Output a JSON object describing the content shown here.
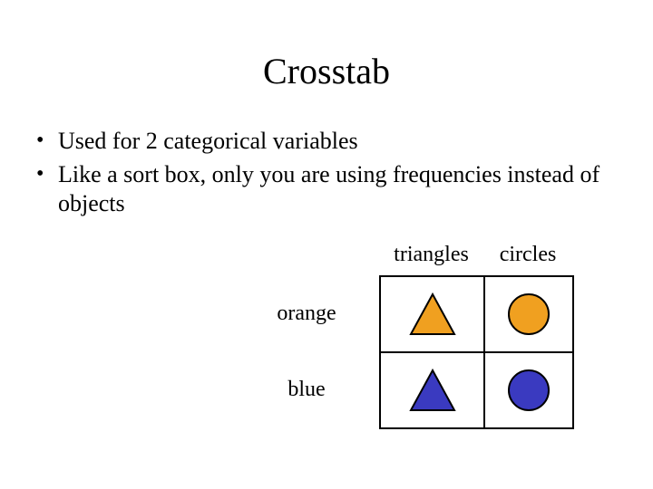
{
  "title": "Crosstab",
  "bullets": [
    "Used for 2 categorical variables",
    "Like a sort box, only you are using frequencies instead of objects"
  ],
  "table": {
    "col_labels": [
      "triangles",
      "circles"
    ],
    "row_labels": [
      "orange",
      "blue"
    ],
    "colors": {
      "orange": "#f0a020",
      "blue": "#3a3ac0",
      "stroke": "#000000"
    },
    "cells": [
      [
        {
          "shape": "triangle",
          "color": "orange"
        },
        {
          "shape": "circle",
          "color": "orange"
        }
      ],
      [
        {
          "shape": "triangle",
          "color": "blue"
        },
        {
          "shape": "circle",
          "color": "blue"
        }
      ]
    ]
  },
  "chart_data": {
    "type": "table",
    "rows": [
      "orange",
      "blue"
    ],
    "columns": [
      "triangles",
      "circles"
    ],
    "values": [
      [
        "orange triangle",
        "orange circle"
      ],
      [
        "blue triangle",
        "blue circle"
      ]
    ],
    "title": "Crosstab"
  }
}
